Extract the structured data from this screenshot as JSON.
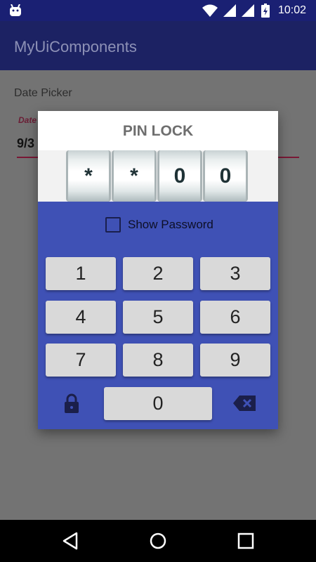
{
  "status_bar": {
    "time": "10:02",
    "icons": [
      "android-icon",
      "wifi-icon",
      "signal-icon",
      "battery-icon"
    ]
  },
  "app_bar": {
    "title": "MyUiComponents"
  },
  "content": {
    "section_label": "Date Picker",
    "field_hint": "Date",
    "field_value": "9/3"
  },
  "dialog": {
    "title": "PIN LOCK",
    "drums": [
      "*",
      "*",
      "0",
      "0"
    ],
    "show_password_label": "Show Password",
    "show_password_checked": false,
    "keys": [
      "1",
      "2",
      "3",
      "4",
      "5",
      "6",
      "7",
      "8",
      "9",
      "0"
    ],
    "lock_icon": "lock-icon",
    "backspace_icon": "backspace-icon"
  },
  "fab": {
    "icon": "lock-icon"
  },
  "nav_bar": {
    "icons": [
      "back-icon",
      "home-icon",
      "recents-icon"
    ]
  },
  "colors": {
    "status_bar": "#1a2073",
    "app_bar": "#1c2263",
    "dialog_background": "#3f51b5",
    "accent": "#7a1a3a",
    "scrim": "#737373"
  }
}
